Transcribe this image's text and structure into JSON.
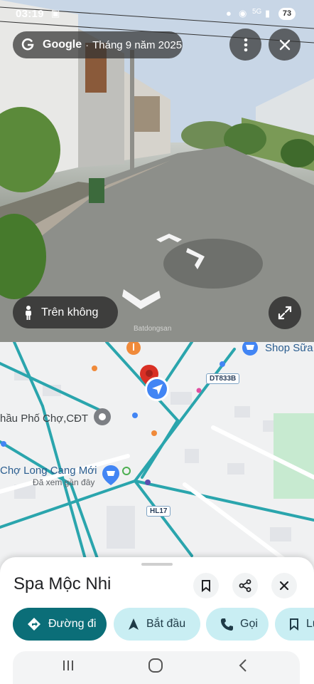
{
  "status_bar": {
    "time": "03:19",
    "battery": "73"
  },
  "street_view": {
    "brand": "Google",
    "date": "Tháng 9 năm 2025",
    "aerial_label": "Trên không",
    "watermark": "Batdongsan"
  },
  "map": {
    "labels": {
      "shop": "Shop Sữa",
      "market_detail": "hầu Phố Chợ,CĐT",
      "market": "Chợ Long Cang Mới",
      "recent": "Đã xem gần đây",
      "road_dt": "DT833B",
      "road_hl": "HL17"
    },
    "road_color": "#2aa5ad",
    "pin_color": "#d93025",
    "location_color": "#4285f4"
  },
  "place": {
    "name": "Spa Mộc Nhi"
  },
  "actions": {
    "directions": "Đường đi",
    "start": "Bắt đầu",
    "call": "Gọi",
    "save": "Lưu"
  }
}
